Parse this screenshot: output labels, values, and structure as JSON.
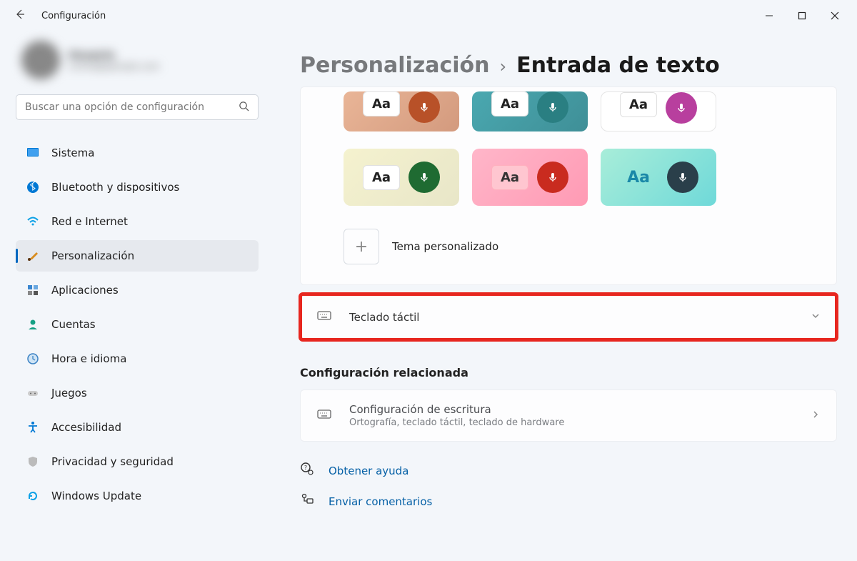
{
  "titlebar": {
    "title": "Configuración"
  },
  "profile": {
    "name": "Usuario",
    "email": "correo@ejemplo.com"
  },
  "search": {
    "placeholder": "Buscar una opción de configuración"
  },
  "sidebar": {
    "items": [
      {
        "label": "Sistema"
      },
      {
        "label": "Bluetooth y dispositivos"
      },
      {
        "label": "Red e Internet"
      },
      {
        "label": "Personalización"
      },
      {
        "label": "Aplicaciones"
      },
      {
        "label": "Cuentas"
      },
      {
        "label": "Hora e idioma"
      },
      {
        "label": "Juegos"
      },
      {
        "label": "Accesibilidad"
      },
      {
        "label": "Privacidad y seguridad"
      },
      {
        "label": "Windows Update"
      }
    ]
  },
  "breadcrumb": {
    "parent": "Personalización",
    "current": "Entrada de texto"
  },
  "themes": {
    "aa_label": "Aa",
    "custom_label": "Tema personalizado"
  },
  "rows": {
    "touch_keyboard": {
      "title": "Teclado táctil"
    },
    "typing_settings": {
      "title": "Configuración de escritura",
      "subtitle": "Ortografía, teclado táctil, teclado de hardware"
    }
  },
  "sections": {
    "related": "Configuración relacionada"
  },
  "links": {
    "help": "Obtener ayuda",
    "feedback": "Enviar comentarios"
  }
}
